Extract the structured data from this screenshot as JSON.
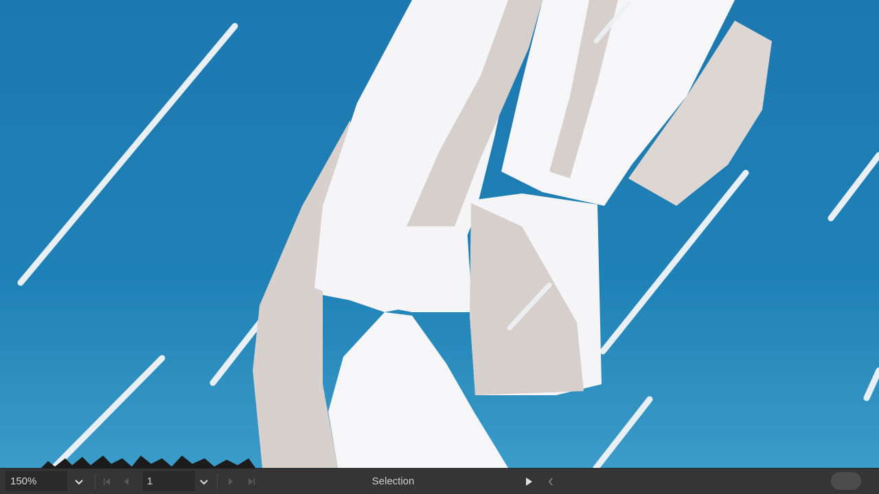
{
  "statusbar": {
    "zoom_value": "150%",
    "page_value": "1",
    "current_tool": "Selection"
  },
  "icons": {
    "zoom_dropdown": "chevron-down-icon",
    "first_page": "first-page-icon",
    "previous_page": "previous-page-icon",
    "page_dropdown": "chevron-down-icon",
    "next_page": "next-page-icon",
    "last_page": "last-page-icon",
    "play": "play-icon",
    "back": "chevron-left-icon"
  },
  "colors": {
    "sky": "#1f7fb5",
    "figure_white": "#f4f4f6",
    "figure_shadow": "#d6cfcb",
    "rain": "#e6eef4",
    "statusbar": "#353535"
  }
}
